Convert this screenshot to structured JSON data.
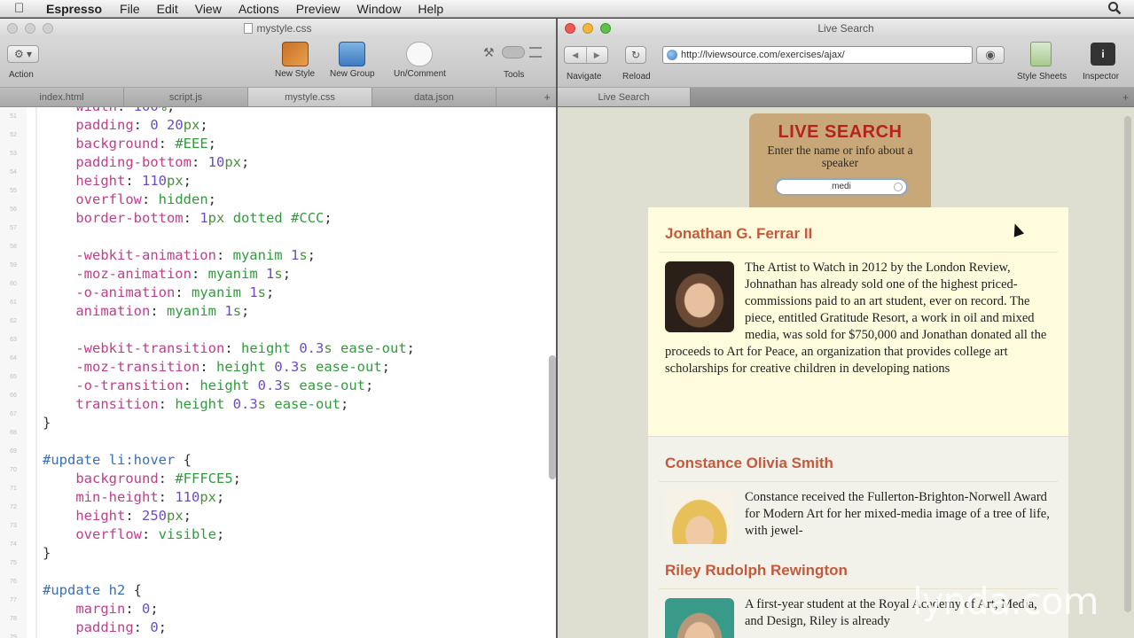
{
  "menubar": {
    "app": "Espresso",
    "items": [
      "File",
      "Edit",
      "View",
      "Actions",
      "Preview",
      "Window",
      "Help"
    ]
  },
  "editor": {
    "title": "mystyle.css",
    "toolbar": {
      "action": "Action",
      "new_style": "New Style",
      "new_group": "New Group",
      "uncomment": "Un/Comment",
      "tools": "Tools"
    },
    "tabs": [
      "index.html",
      "script.js",
      "mystyle.css",
      "data.json"
    ],
    "active_tab": "mystyle.css",
    "tab_add": "+"
  },
  "browser": {
    "title": "Live Search",
    "toolbar": {
      "navigate": "Navigate",
      "reload": "Reload",
      "url": "http://lviewsource.com/exercises/ajax/",
      "style_sheets": "Style Sheets",
      "inspector": "Inspector"
    },
    "tab": "Live Search",
    "tab_add": "+",
    "search": {
      "title": "LIVE SEARCH",
      "subtitle": "Enter the name or info about a speaker",
      "value": "medi"
    },
    "results": [
      {
        "name": "Jonathan G. Ferrar II",
        "bio": "The Artist to Watch in 2012 by the London Review, Johnathan has already sold one of the highest priced-commissions paid to an art student, ever on record. The piece, entitled Gratitude Resort, a work in oil and mixed media, was sold for $750,000 and Jonathan donated all the proceeds to Art for Peace, an organization that provides college art scholarships for creative children in developing nations"
      },
      {
        "name": "Constance Olivia Smith",
        "bio": "Constance received the Fullerton-Brighton-Norwell Award for Modern Art for her mixed-media image of a tree of life, with jewel-"
      },
      {
        "name": "Riley Rudolph Rewington",
        "bio": "A first-year student at the Royal Academy of Art, Media, and Design, Riley is already"
      }
    ]
  },
  "watermark": "lynda.com"
}
